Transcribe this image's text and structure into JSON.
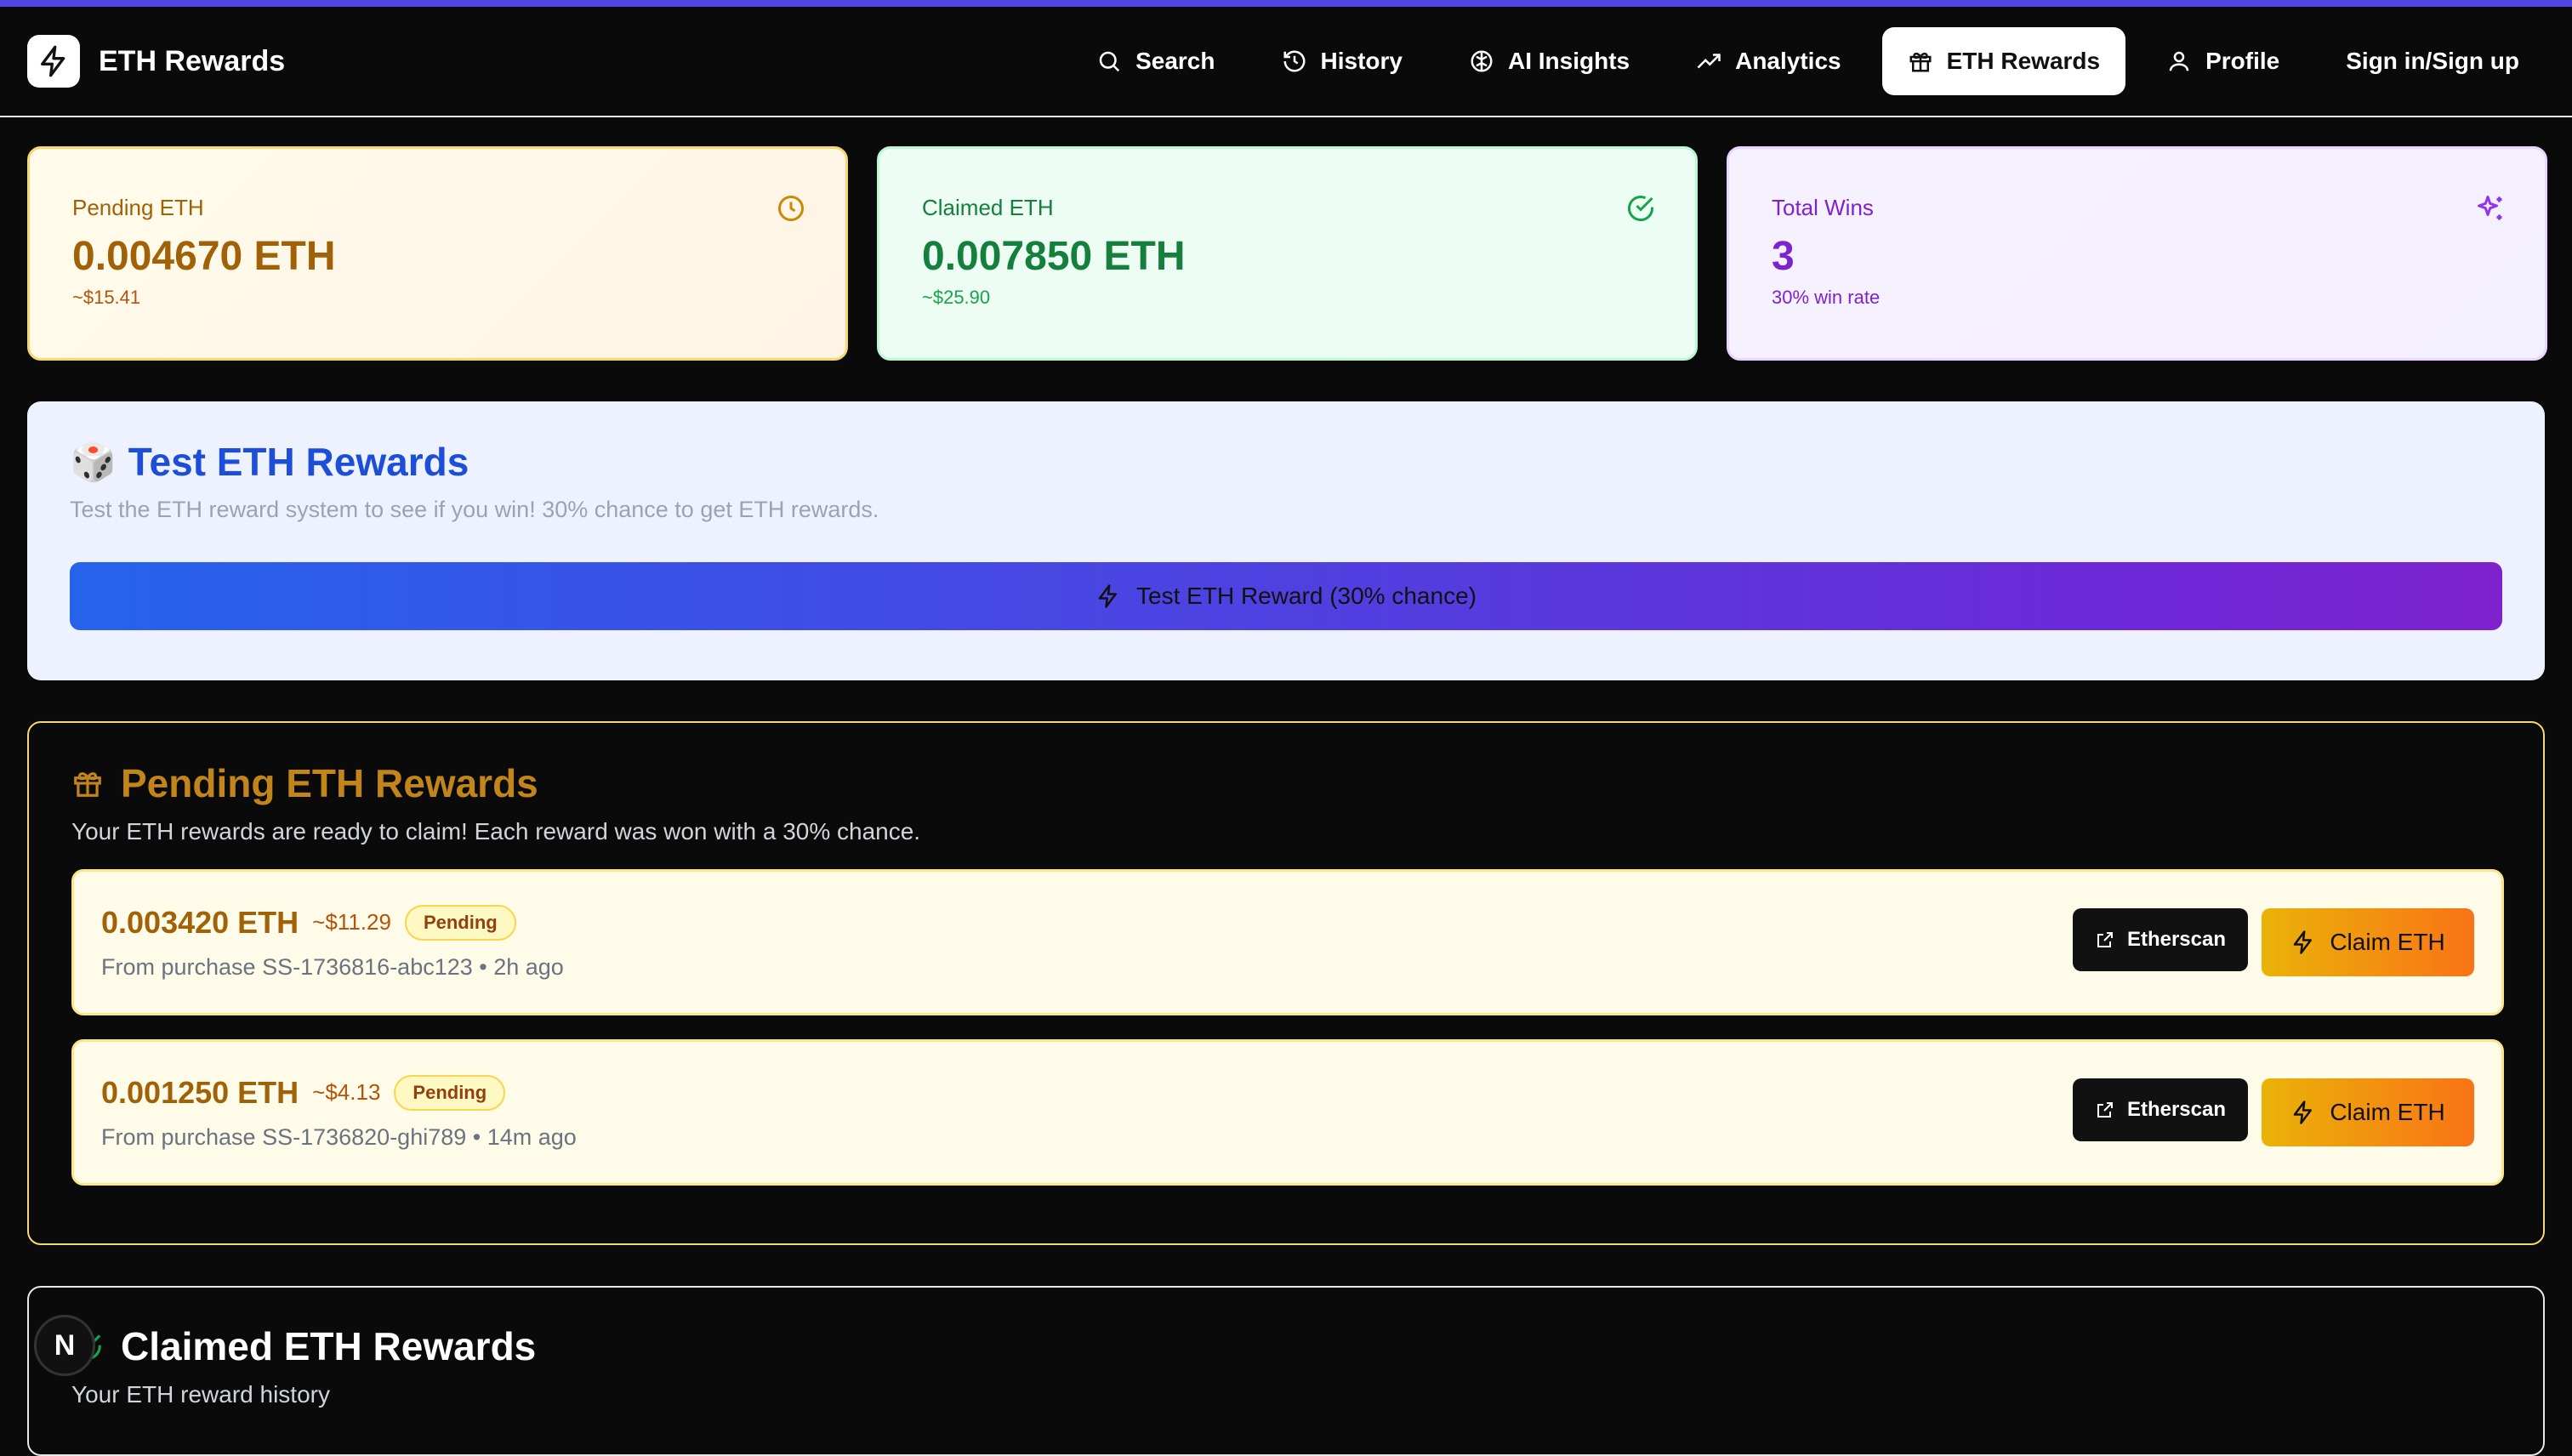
{
  "brand": {
    "name": "ETH Rewards"
  },
  "nav": {
    "items": [
      {
        "label": "Search",
        "icon": "search-icon"
      },
      {
        "label": "History",
        "icon": "history-icon"
      },
      {
        "label": "AI Insights",
        "icon": "brain-icon"
      },
      {
        "label": "Analytics",
        "icon": "trending-up-icon"
      },
      {
        "label": "ETH Rewards",
        "icon": "gift-icon",
        "active": true
      },
      {
        "label": "Profile",
        "icon": "user-icon"
      },
      {
        "label": "Sign in/Sign up"
      }
    ]
  },
  "stats": {
    "pending": {
      "label": "Pending ETH",
      "value": "0.004670 ETH",
      "sub": "~$15.41",
      "icon": "clock-icon"
    },
    "claimed": {
      "label": "Claimed ETH",
      "value": "0.007850 ETH",
      "sub": "~$25.90",
      "icon": "check-circle-icon"
    },
    "wins": {
      "label": "Total Wins",
      "value": "3",
      "sub": "30% win rate",
      "icon": "sparkles-icon"
    }
  },
  "test": {
    "emoji": "🎲",
    "title": "Test ETH Rewards",
    "description": "Test the ETH reward system to see if you win! 30% chance to get ETH rewards.",
    "button_label": "Test ETH Reward (30% chance)"
  },
  "pending_section": {
    "title": "Pending ETH Rewards",
    "description": "Your ETH rewards are ready to claim! Each reward was won with a 30% chance.",
    "rewards": [
      {
        "amount": "0.003420 ETH",
        "usd": "~$11.29",
        "status": "Pending",
        "meta": "From purchase SS-1736816-abc123 • 2h ago",
        "etherscan_label": "Etherscan",
        "claim_label": "Claim ETH"
      },
      {
        "amount": "0.001250 ETH",
        "usd": "~$4.13",
        "status": "Pending",
        "meta": "From purchase SS-1736820-ghi789 • 14m ago",
        "etherscan_label": "Etherscan",
        "claim_label": "Claim ETH"
      }
    ]
  },
  "claimed_section": {
    "title": "Claimed ETH Rewards",
    "description": "Your ETH reward history"
  },
  "dev_badge": {
    "label": "N"
  },
  "colors": {
    "accent": "#4f46e5",
    "pending": "#a16207",
    "claimed": "#15803d",
    "wins": "#7e22ce",
    "test_title": "#1d4ed8"
  }
}
